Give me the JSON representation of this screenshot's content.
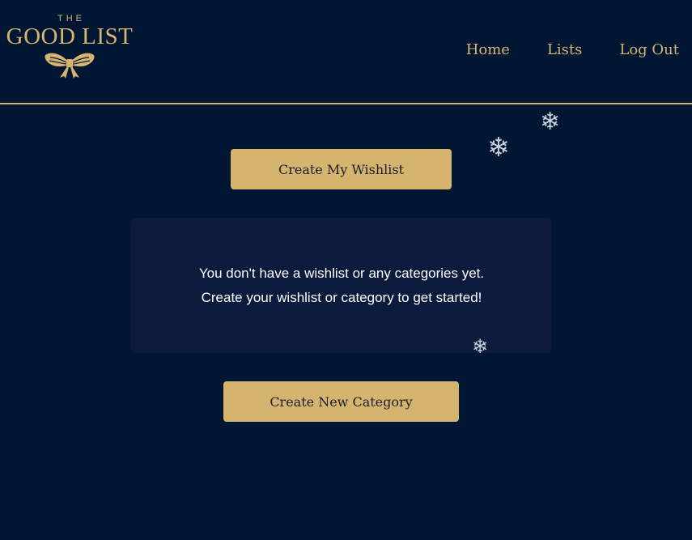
{
  "header": {
    "logo": {
      "the": "THE",
      "name": "GOOD LIST",
      "icon": "bow-icon"
    },
    "nav": {
      "home": "Home",
      "lists": "Lists",
      "logout": "Log Out"
    }
  },
  "main": {
    "create_wishlist_label": "Create My Wishlist",
    "empty_state": {
      "line1": "You don't have a wishlist or any categories yet.",
      "line2": "Create your wishlist or category to get started!"
    },
    "create_category_label": "Create New Category"
  },
  "decorations": {
    "snowflake_icon": "snowflake-icon",
    "snowflake_glyph": "❄"
  },
  "colors": {
    "background": "#011633",
    "accent_gold": "#d4b46e",
    "card": "#0c1b3c",
    "text_white": "#ffffff"
  }
}
